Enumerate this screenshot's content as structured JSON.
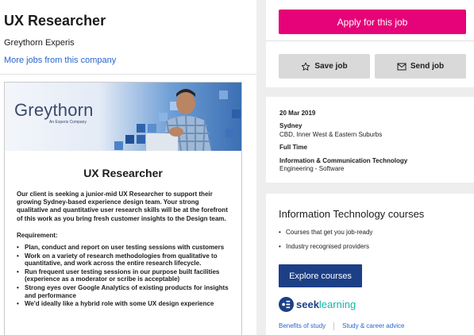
{
  "job": {
    "title": "UX Researcher",
    "company": "Greythorn Experis",
    "more_jobs_link": "More jobs from this company"
  },
  "ad": {
    "logo_text": "Greythorn",
    "logo_sub": "An Experis Company",
    "title": "UX Researcher",
    "intro": "Our client is seeking a junior-mid UX Researcher to support their growing Sydney-based experience design team. Your strong qualitative and quantitative user research skills will be at the forefront of this work as you bring fresh customer insights to the Design team.",
    "requirements_heading": "Requirement:",
    "requirements": [
      "Plan, conduct and report on user testing sessions with customers",
      "Work on a variety of research methodologies from qualitative to quantitative, and work across the entire research lifecycle.",
      "Run frequent user testing sessions in our purpose built facilities (experience as a moderator or scribe is acceptable)",
      "Strong eyes over Google Analytics of existing products for insights and performance",
      "We'd ideally like a hybrid role with some UX design experience"
    ]
  },
  "actions": {
    "apply_label": "Apply for this job",
    "save_label": "Save job",
    "send_label": "Send job"
  },
  "meta": {
    "date": "20 Mar 2019",
    "location": "Sydney",
    "area": "CBD, Inner West & Eastern Suburbs",
    "work_type": "Full Time",
    "classification": "Information & Communication Technology",
    "sub_classification": "Engineering - Software"
  },
  "courses": {
    "title": "Information Technology courses",
    "items": [
      "Courses that get you job-ready",
      "Industry recognised providers"
    ],
    "explore_label": "Explore courses",
    "brand_seek": "seek",
    "brand_learning": "learning",
    "link_benefits": "Benefits of study",
    "link_advice": "Study & career advice"
  },
  "colors": {
    "apply": "#e60278",
    "explore": "#1c3f86",
    "link": "#2765cf"
  }
}
